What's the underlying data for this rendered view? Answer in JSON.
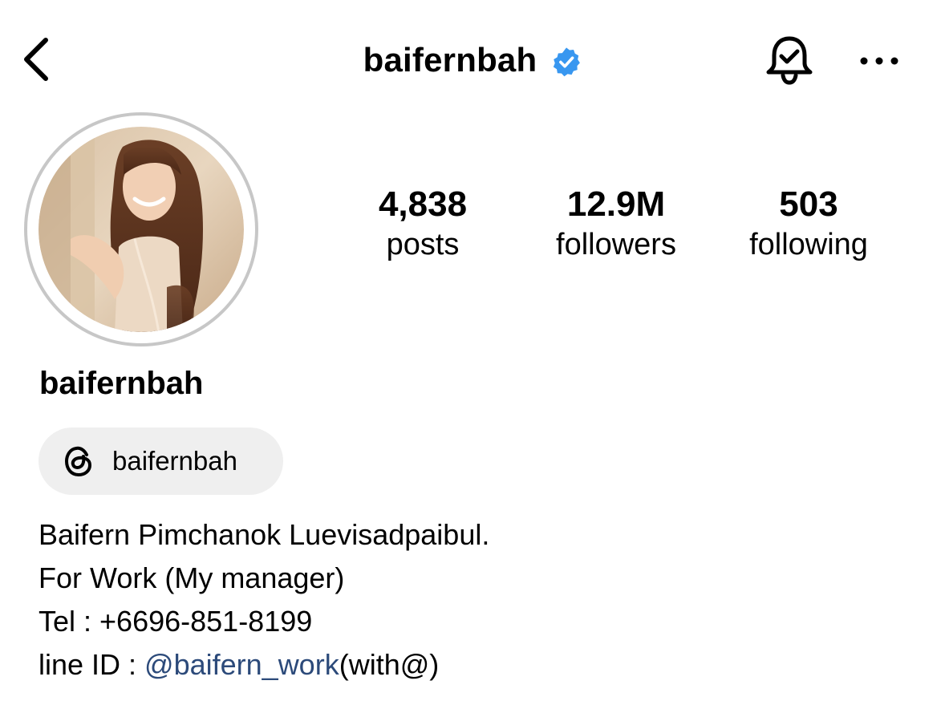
{
  "header": {
    "username": "baifernbah",
    "verified": true,
    "accent_color": "#3897f0"
  },
  "profile": {
    "avatar_description": "profile-photo",
    "name": "baifernbah"
  },
  "stats": [
    {
      "value": "4,838",
      "label": "posts"
    },
    {
      "value": "12.9M",
      "label": "followers"
    },
    {
      "value": "503",
      "label": "following"
    }
  ],
  "threads": {
    "icon": "threads-icon",
    "handle": "baifernbah"
  },
  "bio": {
    "line1": "Baifern Pimchanok Luevisadpaibul.",
    "line2": "For Work (My manager)",
    "line3": "Tel : +6696-851-8199",
    "line4_prefix": "line ID : ",
    "line4_link": "@baifern_work",
    "line4_suffix": "(with@)",
    "link_color": "#2c4a7a"
  },
  "icons": {
    "back": "chevron-left-icon",
    "bell": "bell-check-icon",
    "more": "more-horizontal-icon",
    "verified": "verified-badge-icon"
  }
}
